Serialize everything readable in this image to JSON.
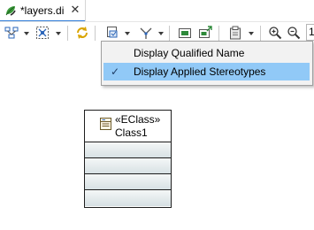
{
  "editor_tab": {
    "title": "*layers.di",
    "icon": "papyrus-leaf-icon",
    "close_glyph": "✕",
    "accent": "#2d7bd8"
  },
  "toolbar": {
    "zoom_value": "1",
    "icons": [
      "arrange-all-icon",
      "select-elements-icon",
      "refresh-icon",
      "filters-icon",
      "routing-style-icon",
      "image-icon",
      "export-icon",
      "clipboard-icon",
      "zoom-in-icon",
      "zoom-out-icon"
    ]
  },
  "context_menu": {
    "items": [
      {
        "label": "Display Qualified Name",
        "checked": false
      },
      {
        "label": "Display Applied Stereotypes",
        "checked": true,
        "check_glyph": "✓"
      }
    ],
    "highlight_color": "#91c9f7"
  },
  "diagram": {
    "class_node": {
      "stereotype": "«EClass»",
      "name": "Class1",
      "icon": "class-icon",
      "compartment_count": 4
    }
  }
}
